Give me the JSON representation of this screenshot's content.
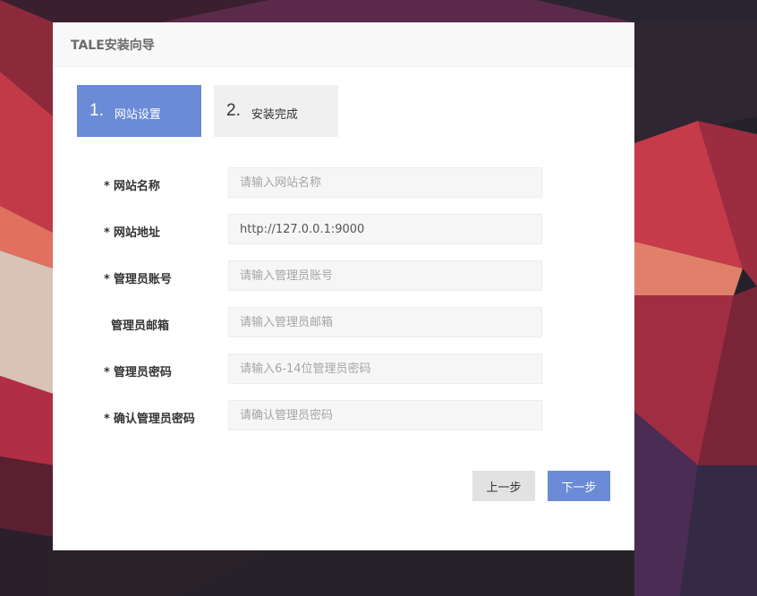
{
  "header": {
    "title": "TALE安装向导"
  },
  "steps": [
    {
      "number": "1.",
      "label": "网站设置",
      "active": true
    },
    {
      "number": "2.",
      "label": "安装完成",
      "active": false
    }
  ],
  "form": {
    "site_name": {
      "label": "网站名称",
      "required": "*",
      "placeholder": "请输入网站名称",
      "value": ""
    },
    "site_url": {
      "label": "网站地址",
      "required": "*",
      "placeholder": "",
      "value": "http://127.0.0.1:9000"
    },
    "admin_user": {
      "label": "管理员账号",
      "required": "*",
      "placeholder": "请输入管理员账号",
      "value": ""
    },
    "admin_email": {
      "label": "管理员邮箱",
      "required": "",
      "placeholder": "请输入管理员邮箱",
      "value": ""
    },
    "admin_pwd": {
      "label": "管理员密码",
      "required": "*",
      "placeholder": "请输入6-14位管理员密码",
      "value": ""
    },
    "admin_pwd_confirm": {
      "label": "确认管理员密码",
      "required": "*",
      "placeholder": "请确认管理员密码",
      "value": ""
    }
  },
  "buttons": {
    "prev": "上一步",
    "next": "下一步"
  },
  "colors": {
    "accent": "#6b8bd6",
    "panel": "#ffffff",
    "header_bg": "#f8f8f8"
  }
}
